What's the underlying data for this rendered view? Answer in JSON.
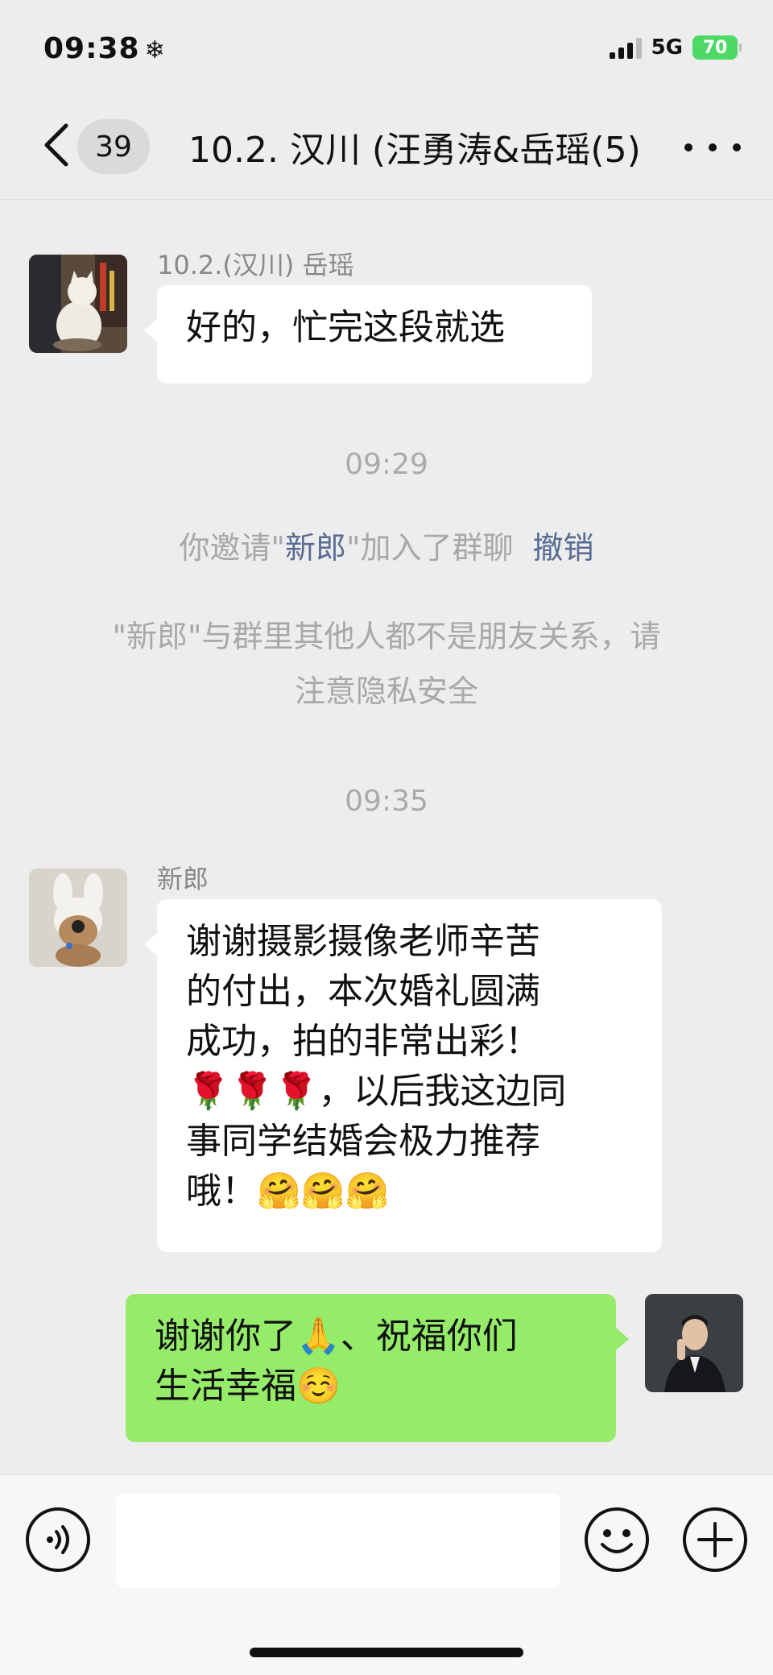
{
  "status_bar": {
    "time": "09:38",
    "weather_glyph": "❄",
    "network": "5G",
    "battery": "70"
  },
  "nav": {
    "unread_count": "39",
    "title": "10.2. 汉川 (汪勇涛&岳瑶(5)"
  },
  "messages": [
    {
      "sender": "10.2.(汉川) 岳瑶",
      "text": "好的，忙完这段就选",
      "side": "left"
    },
    {
      "sender": "新郎",
      "lines": [
        "谢谢摄影摄像老师辛苦",
        "的付出，本次婚礼圆满",
        "成功，拍的非常出彩！",
        "🌹🌹🌹，以后我这边同",
        "事同学结婚会极力推荐",
        "哦！🤗🤗🤗"
      ],
      "side": "left"
    },
    {
      "lines": [
        "谢谢你了🙏、祝福你们",
        "生活幸福☺️"
      ],
      "side": "right"
    }
  ],
  "timestamps": [
    "09:29",
    "09:35"
  ],
  "system": {
    "invite_prefix": "你邀请\"",
    "invite_name": "新郎",
    "invite_suffix": "\"加入了群聊",
    "undo_label": "撤销",
    "privacy_line1": "\"新郎\"与群里其他人都不是朋友关系，请",
    "privacy_line2": "注意隐私安全"
  },
  "input_bar": {
    "value": ""
  },
  "icons": {
    "back": "chevron-left-icon",
    "more": "more-icon",
    "voice": "voice-icon",
    "emoji": "emoji-icon",
    "plus": "plus-icon"
  },
  "colors": {
    "background": "#ededed",
    "bubble_self": "#95ec69",
    "bubble_other": "#ffffff",
    "link": "#576b95"
  }
}
